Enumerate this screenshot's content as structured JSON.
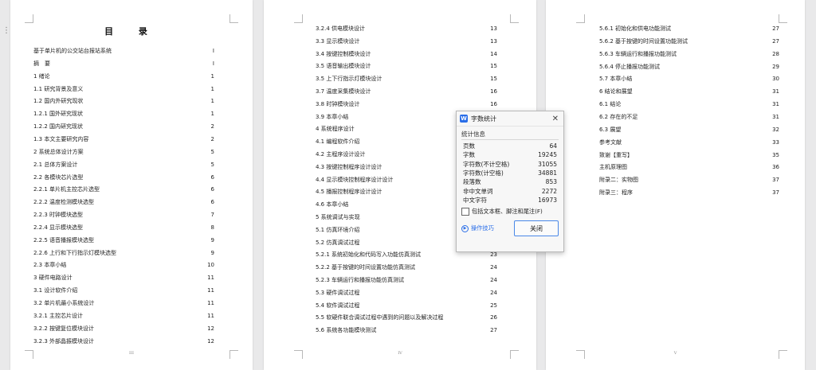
{
  "pages": [
    {
      "title": "目  录",
      "footer": "III",
      "entries": [
        {
          "text": "基于单片机的公交站台报站系统",
          "page": "I"
        },
        {
          "text": "摘　要",
          "page": "I"
        },
        {
          "text": "1 绪论",
          "page": "1"
        },
        {
          "text": "1.1 研究背景及意义",
          "page": "1"
        },
        {
          "text": "1.2 国内外研究现状",
          "page": "1"
        },
        {
          "text": "1.2.1 国外研究现状",
          "page": "1"
        },
        {
          "text": "1.2.2 国内研究现状",
          "page": "2"
        },
        {
          "text": "1.3 本文主要研究内容",
          "page": "2"
        },
        {
          "text": "2 系统总体设计方案",
          "page": "5"
        },
        {
          "text": "2.1 总体方案设计",
          "page": "5"
        },
        {
          "text": "2.2 各模块芯片选型",
          "page": "6"
        },
        {
          "text": "2.2.1 单片机主控芯片选型",
          "page": "6"
        },
        {
          "text": "2.2.2 温度检测模块选型",
          "page": "6"
        },
        {
          "text": "2.2.3 时钟模块选型",
          "page": "7"
        },
        {
          "text": "2.2.4 显示模块选型",
          "page": "8"
        },
        {
          "text": "2.2.5 语音播报模块选型",
          "page": "9"
        },
        {
          "text": "2.2.6 上行和下行指示灯模块选型",
          "page": "9"
        },
        {
          "text": "2.3 本章小结",
          "page": "10"
        },
        {
          "text": "3 硬件电路设计",
          "page": "11"
        },
        {
          "text": "3.1 设计软件介绍",
          "page": "11"
        },
        {
          "text": "3.2 单片机最小系统设计",
          "page": "11"
        },
        {
          "text": "3.2.1 主控芯片设计",
          "page": "11"
        },
        {
          "text": "3.2.2 按键复位模块设计",
          "page": "12"
        },
        {
          "text": "3.2.3 外部晶振模块设计",
          "page": "12"
        }
      ]
    },
    {
      "footer": "IV",
      "entries": [
        {
          "text": "3.2.4 供电模块设计",
          "page": "13"
        },
        {
          "text": "3.3 显示模块设计",
          "page": "13"
        },
        {
          "text": "3.4 按键控制模块设计",
          "page": "14"
        },
        {
          "text": "3.5 语音输出模块设计",
          "page": "15"
        },
        {
          "text": "3.5 上下行指示灯模块设计",
          "page": "15"
        },
        {
          "text": "3.7 温度采集模块设计",
          "page": "16"
        },
        {
          "text": "3.8 时钟模块设计",
          "page": "16"
        },
        {
          "text": "3.9 本章小结",
          "page": "17"
        },
        {
          "text": "4 系统程序设计",
          "page": "18"
        },
        {
          "text": "4.1 编程软件介绍",
          "page": "18"
        },
        {
          "text": "4.2 主程序设计设计",
          "page": "19"
        },
        {
          "text": "4.3 按键控制程序设计设计",
          "page": "20"
        },
        {
          "text": "4.4 显示模块控制程序设计设计",
          "page": "20"
        },
        {
          "text": "4.5 播报控制程序设计设计",
          "page": "21"
        },
        {
          "text": "4.6 本章小结",
          "page": "21"
        },
        {
          "text": "5 系统调试与实现",
          "page": "22"
        },
        {
          "text": "5.1 仿真环境介绍",
          "page": "22"
        },
        {
          "text": "5.2 仿真调试过程",
          "page": "23"
        },
        {
          "text": "5.2.1 系统初始化和代码写入功能仿真测试",
          "page": "23"
        },
        {
          "text": "5.2.2 基于按键的时间设置功能仿真测试",
          "page": "24"
        },
        {
          "text": "5.2.3 车辆运行和播报功能仿真测试",
          "page": "24"
        },
        {
          "text": "5.3 硬件调试过程",
          "page": "24"
        },
        {
          "text": "5.4 软件调试过程",
          "page": "25"
        },
        {
          "text": "5.5 软硬件联合调试过程中遇到的问题以及解决过程",
          "page": "26"
        },
        {
          "text": "5.6 系统各功能模块测试",
          "page": "27"
        }
      ]
    },
    {
      "footer": "V",
      "entries": [
        {
          "text": "5.6.1 初始化和供电功能测试",
          "page": "27"
        },
        {
          "text": "5.6.2 基于按键的时间设置功能测试",
          "page": "27"
        },
        {
          "text": "5.6.3 车辆运行和播报功能测试",
          "page": "28"
        },
        {
          "text": "5.6.4 停止播报功能测试",
          "page": "29"
        },
        {
          "text": "5.7 本章小结",
          "page": "30"
        },
        {
          "text": "6 结论和展望",
          "page": "31"
        },
        {
          "text": "6.1 结论",
          "page": "31"
        },
        {
          "text": "6.2 存在的不足",
          "page": "31"
        },
        {
          "text": "6.3 展望",
          "page": "32"
        },
        {
          "text": "参考文献",
          "page": "33"
        },
        {
          "text": "致谢【重写】",
          "page": "35"
        },
        {
          "text": "主机原理图",
          "page": "36"
        },
        {
          "text": "附录二：实物图",
          "page": "37"
        },
        {
          "text": "附录三：程序",
          "page": "37"
        }
      ]
    }
  ],
  "dialog": {
    "app_icon": "W",
    "title": "字数统计",
    "close_icon": "✕",
    "section_label": "统计信息",
    "stats": [
      {
        "label": "页数",
        "value": "64"
      },
      {
        "label": "字数",
        "value": "19245"
      },
      {
        "label": "字符数(不计空格)",
        "value": "31055"
      },
      {
        "label": "字符数(计空格)",
        "value": "34881"
      },
      {
        "label": "段落数",
        "value": "853"
      },
      {
        "label": "非中文单词",
        "value": "2272"
      },
      {
        "label": "中文字符",
        "value": "16973"
      }
    ],
    "checkbox_label": "包括文本框、脚注和尾注(F)",
    "checkbox_checked": false,
    "tips_label": "操作技巧",
    "close_button": "关闭"
  },
  "colors": {
    "accent": "#2a6ee8",
    "background": "#e9e9ea",
    "page": "#ffffff"
  }
}
